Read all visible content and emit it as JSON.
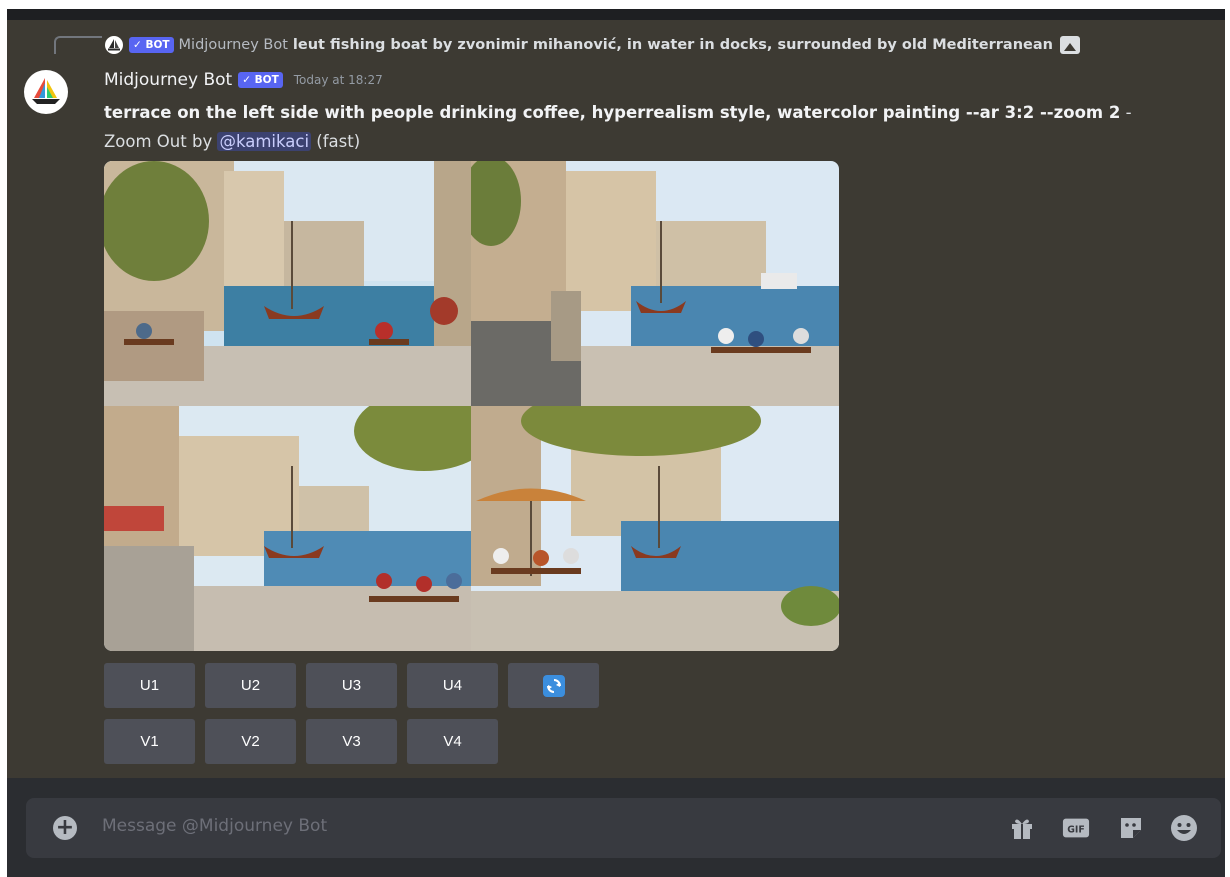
{
  "reply": {
    "badge": "✓ BOT",
    "author": "Midjourney Bot",
    "text": "leut fishing boat by zvonimir mihanović, in water in docks, surrounded by old Mediterranean"
  },
  "message": {
    "author": "Midjourney Bot",
    "badge": "✓ BOT",
    "timestamp": "Today at 18:27",
    "prompt": "terrace on the left side with people drinking coffee, hyperrealism style, watercolor painting --ar 3:2 --zoom 2",
    "separator": " - Zoom Out by ",
    "mention": "@kamikaci",
    "speed": " (fast)"
  },
  "buttons": {
    "row1": [
      "U1",
      "U2",
      "U3",
      "U4"
    ],
    "row2": [
      "V1",
      "V2",
      "V3",
      "V4"
    ]
  },
  "composer": {
    "placeholder": "Message @Midjourney Bot"
  },
  "icons": [
    "add-circle-icon",
    "gift-icon",
    "gif-icon",
    "sticker-icon",
    "emoji-icon",
    "reroll-icon",
    "image-icon",
    "boat-avatar-icon"
  ]
}
